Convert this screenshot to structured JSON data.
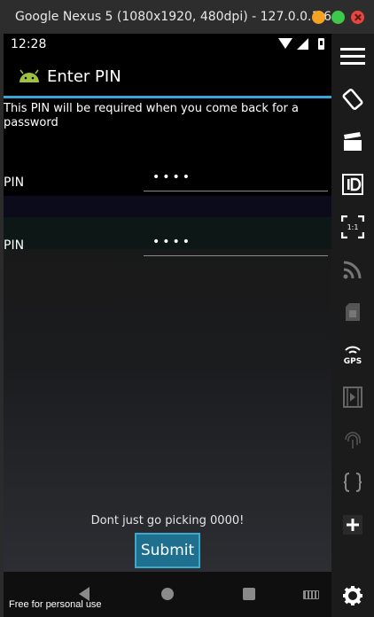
{
  "window": {
    "title": "Google Nexus 5 (1080x1920, 480dpi) - 127.0.0.1:6…"
  },
  "statusbar": {
    "time": "12:28"
  },
  "app": {
    "title": "Enter PIN",
    "instruction": "This PIN will be required when you come back for a password",
    "fields": [
      {
        "label": "PIN",
        "value": "••••"
      },
      {
        "label": "PIN",
        "value": "••••"
      }
    ],
    "hint": "Dont just go picking 0000!",
    "submit_label": "Submit"
  },
  "sidebar": {
    "gps_label": "GPS",
    "one_to_one_label": "1:1"
  },
  "overlay": {
    "watermark": "Free for personal use"
  },
  "colors": {
    "accent": "#3aa4d8",
    "button": "#1f6f8f"
  }
}
